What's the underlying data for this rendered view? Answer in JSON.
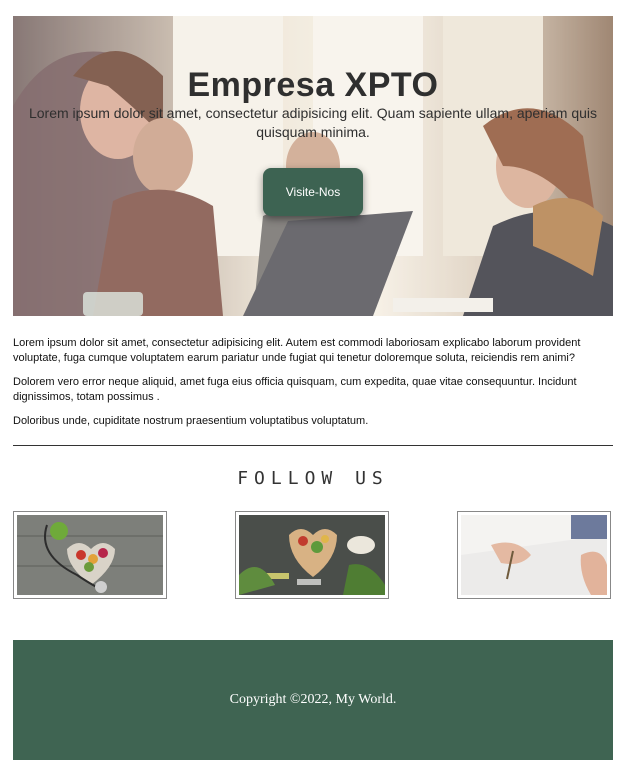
{
  "hero": {
    "title": "Empresa XPTO",
    "subtitle": "Lorem ipsum dolor sit amet, consectetur adipisicing elit. Quam sapiente ullam, aperiam quis quisquam minima.",
    "button_label": "Visite-Nos"
  },
  "content": {
    "paragraphs": [
      "Lorem ipsum dolor sit amet, consectetur adipisicing elit. Autem est commodi laboriosam explicabo laborum provident voluptate, fuga cumque voluptatem earum pariatur unde fugiat qui tenetur doloremque soluta, reiciendis rem animi?",
      "Dolorem vero error neque aliquid, amet fuga eius officia quisquam, cum expedita, quae vitae consequuntur. Incidunt dignissimos, totam possimus .",
      "Doloribus unde, cupiditate nostrum praesentium voluptatibus voluptatum."
    ]
  },
  "follow": {
    "title": "FOLLOW US",
    "images": [
      "stethoscope-heart-bowl-photo",
      "vegetables-dumbbells-photo",
      "writing-hand-photo"
    ]
  },
  "footer": {
    "copyright": "Copyright ©2022, My World."
  },
  "colors": {
    "accent": "#3f6452",
    "text": "#2f2f2f"
  }
}
